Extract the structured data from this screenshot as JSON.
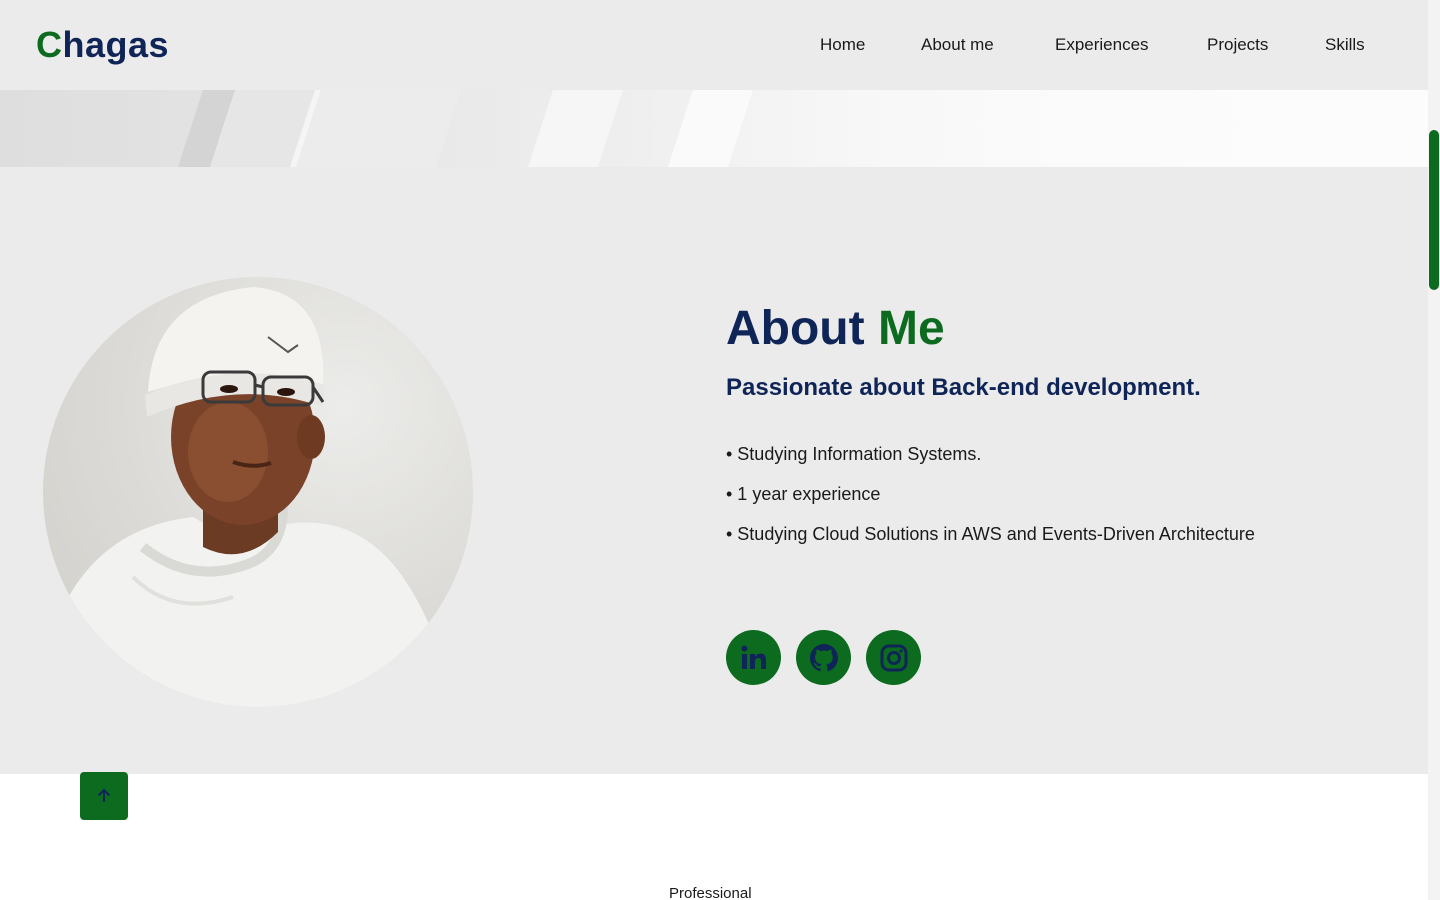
{
  "header": {
    "logo_first": "C",
    "logo_rest": "hagas",
    "nav": [
      "Home",
      "About me",
      "Experiences",
      "Projects",
      "Skills"
    ]
  },
  "about": {
    "title_part1": "About",
    "title_part2": "Me",
    "subtitle": "Passionate about Back-end development.",
    "bullets": [
      "• Studying Information Systems.",
      "• 1 year experience",
      "• Studying Cloud Solutions in AWS and Events-Driven Architecture"
    ],
    "social": [
      "linkedin-icon",
      "github-icon",
      "instagram-icon"
    ],
    "photo_icon": "profile-photo"
  },
  "next_section": {
    "label": "Professional"
  },
  "controls": {
    "back_to_top_icon": "arrow-up-icon"
  },
  "colors": {
    "brand_green": "#0c6b1e",
    "brand_navy": "#0f2557",
    "section_bg": "#ebebec"
  }
}
